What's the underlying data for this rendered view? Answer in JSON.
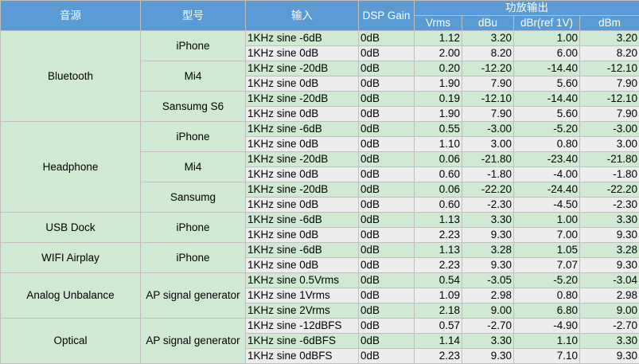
{
  "headers": {
    "source": "音源",
    "model": "型号",
    "input": "输入",
    "dsp_gain": "DSP Gain",
    "amp_output": "功放输出",
    "vrms": "Vrms",
    "dbu": "dBu",
    "dbr": "dBr(ref 1V)",
    "dbm": "dBm"
  },
  "groups": [
    {
      "source": "Bluetooth",
      "models": [
        {
          "model": "iPhone",
          "rows": [
            {
              "input": "1KHz sine -6dB",
              "dsp": "0dB",
              "vrms": "1.12",
              "dbu": "3.20",
              "dbr": "1.00",
              "dbm": "3.20"
            },
            {
              "input": "1KHz sine 0dB",
              "dsp": "0dB",
              "vrms": "2.00",
              "dbu": "8.20",
              "dbr": "6.00",
              "dbm": "8.20"
            }
          ]
        },
        {
          "model": "Mi4",
          "rows": [
            {
              "input": "1KHz sine -20dB",
              "dsp": "0dB",
              "vrms": "0.20",
              "dbu": "-12.20",
              "dbr": "-14.40",
              "dbm": "-12.10"
            },
            {
              "input": "1KHz sine 0dB",
              "dsp": "0dB",
              "vrms": "1.90",
              "dbu": "7.90",
              "dbr": "5.60",
              "dbm": "7.90"
            }
          ]
        },
        {
          "model": "Sansumg S6",
          "rows": [
            {
              "input": "1KHz sine -20dB",
              "dsp": "0dB",
              "vrms": "0.19",
              "dbu": "-12.10",
              "dbr": "-14.40",
              "dbm": "-12.10"
            },
            {
              "input": "1KHz sine 0dB",
              "dsp": "0dB",
              "vrms": "1.90",
              "dbu": "7.90",
              "dbr": "5.60",
              "dbm": "7.90"
            }
          ]
        }
      ]
    },
    {
      "source": "Headphone",
      "models": [
        {
          "model": "iPhone",
          "rows": [
            {
              "input": "1KHz sine -6dB",
              "dsp": "0dB",
              "vrms": "0.55",
              "dbu": "-3.00",
              "dbr": "-5.20",
              "dbm": "-3.00"
            },
            {
              "input": "1KHz sine 0dB",
              "dsp": "0dB",
              "vrms": "1.10",
              "dbu": "3.00",
              "dbr": "0.80",
              "dbm": "3.00"
            }
          ]
        },
        {
          "model": "Mi4",
          "rows": [
            {
              "input": "1KHz sine -20dB",
              "dsp": "0dB",
              "vrms": "0.06",
              "dbu": "-21.80",
              "dbr": "-23.40",
              "dbm": "-21.80"
            },
            {
              "input": "1KHz sine 0dB",
              "dsp": "0dB",
              "vrms": "0.60",
              "dbu": "-1.80",
              "dbr": "-4.00",
              "dbm": "-1.80"
            }
          ]
        },
        {
          "model": "Sansumg",
          "rows": [
            {
              "input": "1KHz sine -20dB",
              "dsp": "0dB",
              "vrms": "0.06",
              "dbu": "-22.20",
              "dbr": "-24.40",
              "dbm": "-22.20"
            },
            {
              "input": "1KHz sine 0dB",
              "dsp": "0dB",
              "vrms": "0.60",
              "dbu": "-2.30",
              "dbr": "-4.50",
              "dbm": "-2.30"
            }
          ]
        }
      ]
    },
    {
      "source": "USB Dock",
      "models": [
        {
          "model": "iPhone",
          "rows": [
            {
              "input": "1KHz sine -6dB",
              "dsp": "0dB",
              "vrms": "1.13",
              "dbu": "3.30",
              "dbr": "1.00",
              "dbm": "3.30"
            },
            {
              "input": "1KHz sine 0dB",
              "dsp": "0dB",
              "vrms": "2.23",
              "dbu": "9.30",
              "dbr": "7.00",
              "dbm": "9.30"
            }
          ]
        }
      ]
    },
    {
      "source": "WIFI Airplay",
      "models": [
        {
          "model": "iPhone",
          "rows": [
            {
              "input": "1KHz sine -6dB",
              "dsp": "0dB",
              "vrms": "1.13",
              "dbu": "3.28",
              "dbr": "1.05",
              "dbm": "3.28"
            },
            {
              "input": "1KHz sine 0dB",
              "dsp": "0dB",
              "vrms": "2.23",
              "dbu": "9.30",
              "dbr": "7.07",
              "dbm": "9.30"
            }
          ]
        }
      ]
    },
    {
      "source": "Analog Unbalance",
      "models": [
        {
          "model": "AP signal generator",
          "rows": [
            {
              "input": "1KHz sine 0.5Vrms",
              "dsp": "0dB",
              "vrms": "0.54",
              "dbu": "-3.05",
              "dbr": "-5.20",
              "dbm": "-3.04"
            },
            {
              "input": "1KHz sine 1Vrms",
              "dsp": "0dB",
              "vrms": "1.09",
              "dbu": "2.98",
              "dbr": "0.80",
              "dbm": "2.98"
            },
            {
              "input": "1KHz sine 2Vrms",
              "dsp": "0dB",
              "vrms": "2.18",
              "dbu": "9.00",
              "dbr": "6.80",
              "dbm": "9.00"
            }
          ]
        }
      ]
    },
    {
      "source": "Optical",
      "models": [
        {
          "model": "AP signal generator",
          "rows": [
            {
              "input": "1KHz sine -12dBFS",
              "dsp": "0dB",
              "vrms": "0.57",
              "dbu": "-2.70",
              "dbr": "-4.90",
              "dbm": "-2.70"
            },
            {
              "input": "1KHz sine -6dBFS",
              "dsp": "0dB",
              "vrms": "1.14",
              "dbu": "3.30",
              "dbr": "1.10",
              "dbm": "3.30"
            },
            {
              "input": "1KHz sine  0dBFS",
              "dsp": "0dB",
              "vrms": "2.23",
              "dbu": "9.30",
              "dbr": "7.10",
              "dbm": "9.30"
            }
          ]
        }
      ]
    }
  ]
}
